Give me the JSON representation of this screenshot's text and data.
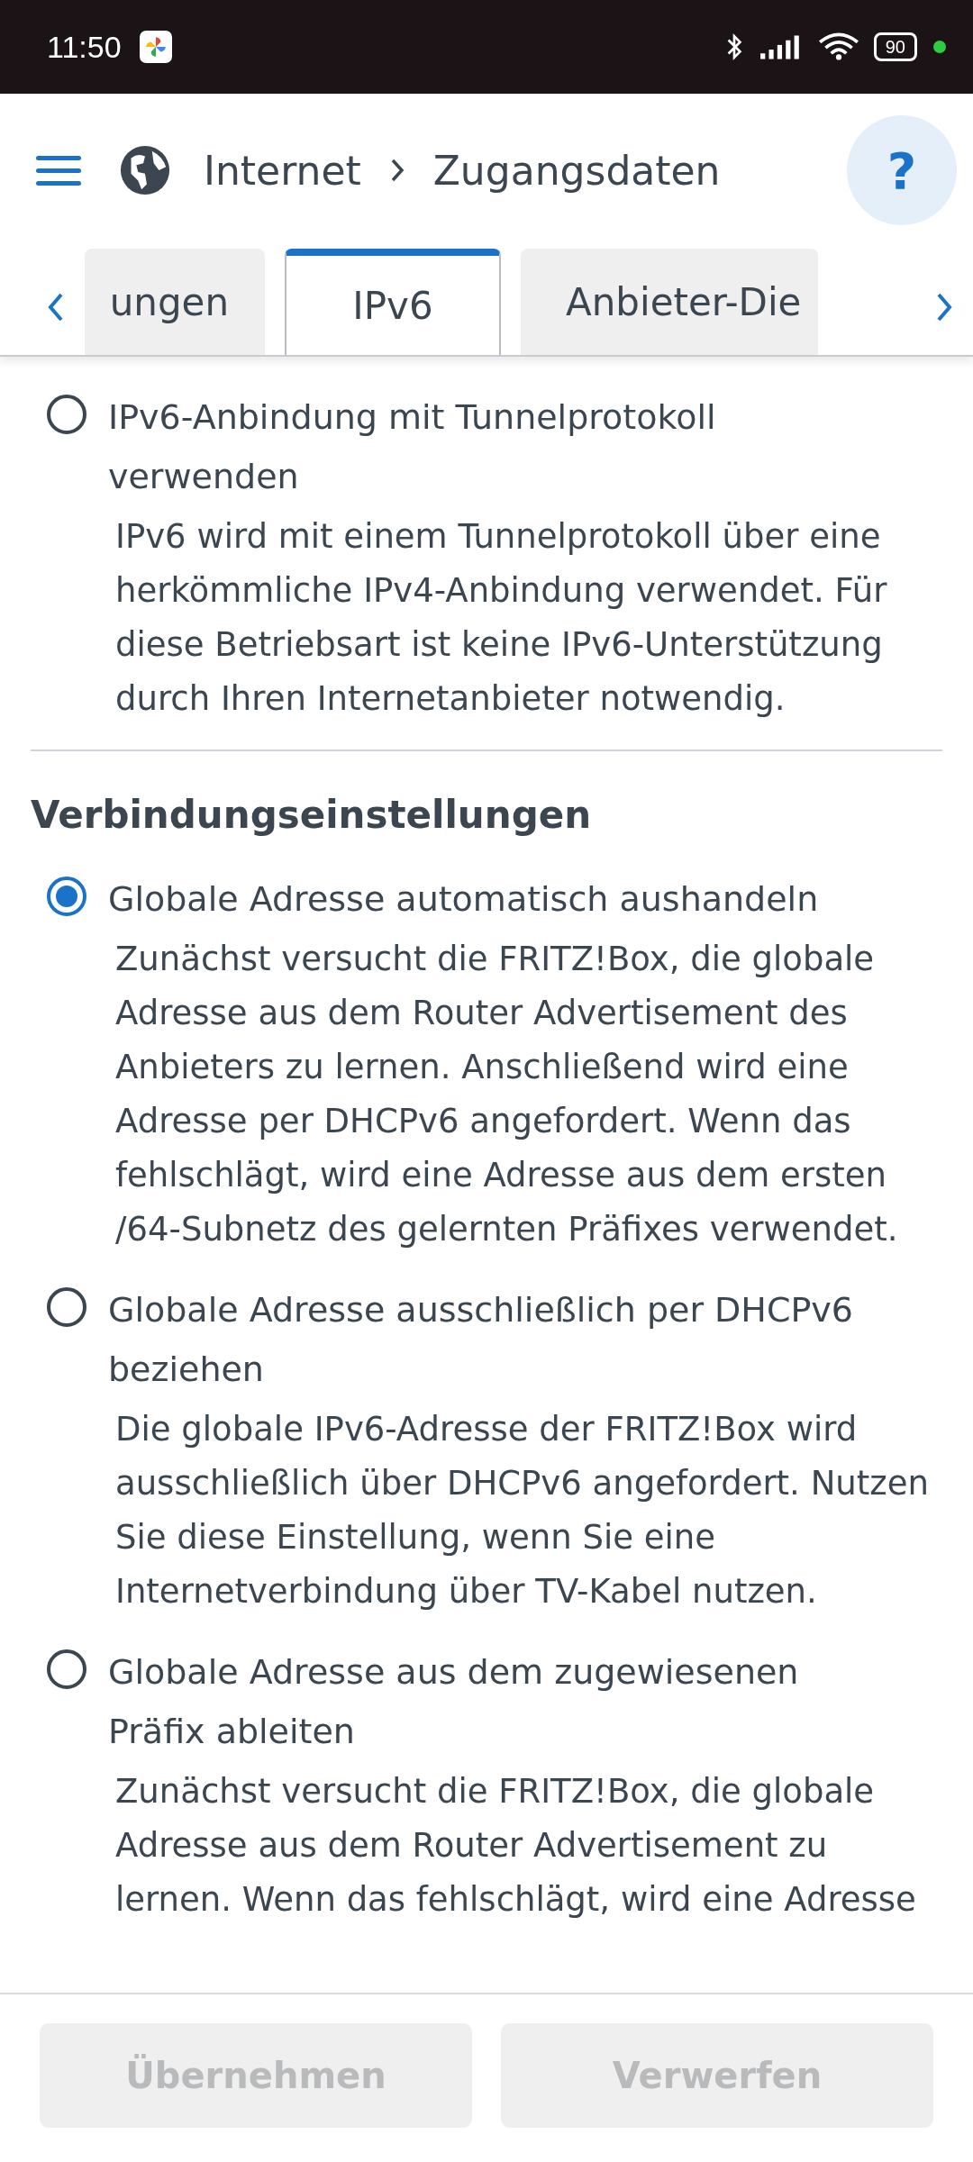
{
  "status_bar": {
    "time": "11:50",
    "battery": "90"
  },
  "header": {
    "breadcrumb": [
      "Internet",
      "Zugangsdaten"
    ],
    "help": "?"
  },
  "tabs": [
    {
      "label": "ungen",
      "selected": false
    },
    {
      "label": "IPv6",
      "selected": true
    },
    {
      "label": "Anbieter-Die",
      "selected": false
    }
  ],
  "options_top": [
    {
      "label": "IPv6-Anbindung mit Tunnelprotokoll verwenden",
      "selected": false,
      "description": "IPv6 wird mit einem Tunnelprotokoll über eine herkömmliche IPv4-Anbindung verwendet. Für diese Betriebsart ist keine IPv6-Unterstützung durch Ihren Internetanbieter notwendig."
    }
  ],
  "section": {
    "title": "Verbindungseinstellungen",
    "options": [
      {
        "label": "Globale Adresse automatisch aushandeln",
        "selected": true,
        "description": "Zunächst versucht die FRITZ!Box, die globale Adresse aus dem Router Advertisement des Anbieters zu lernen. Anschließend wird eine Adresse per DHCPv6 angefordert. Wenn das fehlschlägt, wird eine Adresse aus dem ersten /64-Subnetz des gelernten Präfixes verwendet."
      },
      {
        "label": "Globale Adresse ausschließlich per DHCPv6 beziehen",
        "selected": false,
        "description": "Die globale IPv6-Adresse der FRITZ!Box wird ausschließlich über DHCPv6 angefordert. Nutzen Sie diese Einstellung, wenn Sie eine Internetverbindung über TV-Kabel nutzen."
      },
      {
        "label": "Globale Adresse aus dem zugewiesenen Präfix ableiten",
        "selected": false,
        "description": "Zunächst versucht die FRITZ!Box, die globale Adresse aus dem Router Advertisement zu lernen. Wenn das fehlschlägt, wird eine Adresse"
      }
    ]
  },
  "footer": [
    {
      "label": "Übernehmen",
      "disabled": true
    },
    {
      "label": "Verwerfen",
      "disabled": true
    }
  ]
}
